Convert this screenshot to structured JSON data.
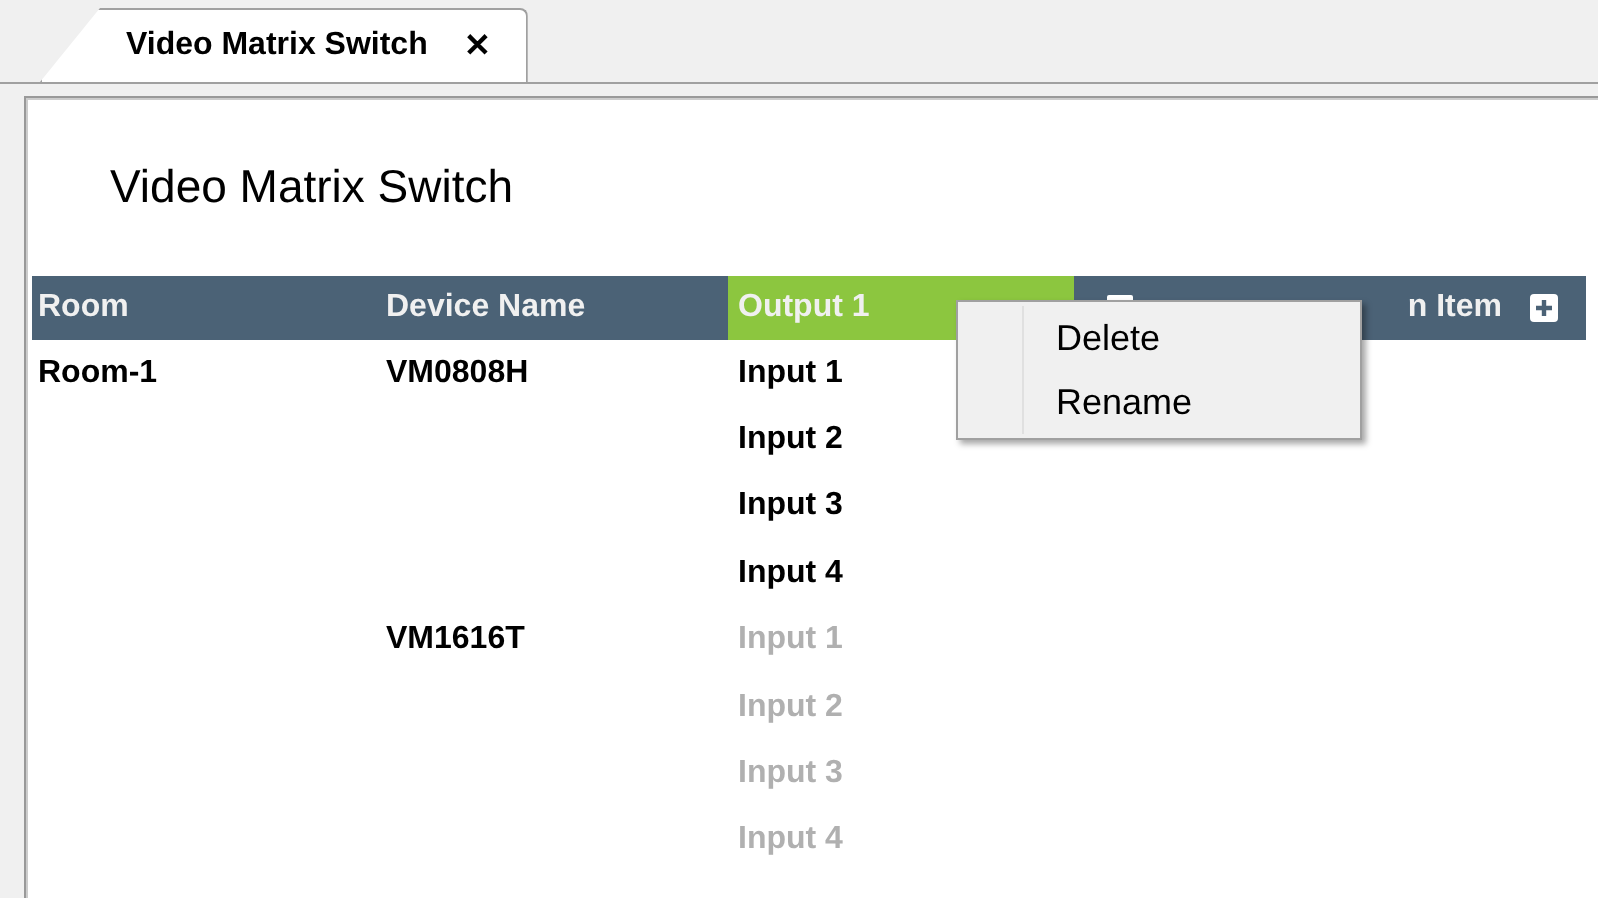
{
  "tabs": [
    {
      "label": "Video Matrix Switch",
      "selected": true,
      "close": "✕"
    }
  ],
  "page_title": "Video Matrix Switch",
  "table": {
    "columns": [
      {
        "label": "Room",
        "kind": "plain"
      },
      {
        "label": "Device Name",
        "kind": "plain"
      },
      {
        "label": "Output 1",
        "kind": "output"
      },
      {
        "label": "n Item",
        "kind": "add"
      }
    ],
    "rooms": [
      {
        "name": "Room-1",
        "devices": [
          {
            "name": "VM0808H",
            "inputs": [
              {
                "label": "Input 1",
                "disabled": false
              },
              {
                "label": "Input 2",
                "disabled": false
              },
              {
                "label": "Input 3",
                "disabled": false
              },
              {
                "label": "Input 4",
                "disabled": false
              }
            ]
          },
          {
            "name": "VM1616T",
            "inputs": [
              {
                "label": "Input 1",
                "disabled": true
              },
              {
                "label": "Input 2",
                "disabled": true
              },
              {
                "label": "Input 3",
                "disabled": true
              },
              {
                "label": "Input 4",
                "disabled": true
              }
            ]
          }
        ]
      }
    ]
  },
  "context_menu": {
    "items": [
      "Delete",
      "Rename"
    ]
  }
}
